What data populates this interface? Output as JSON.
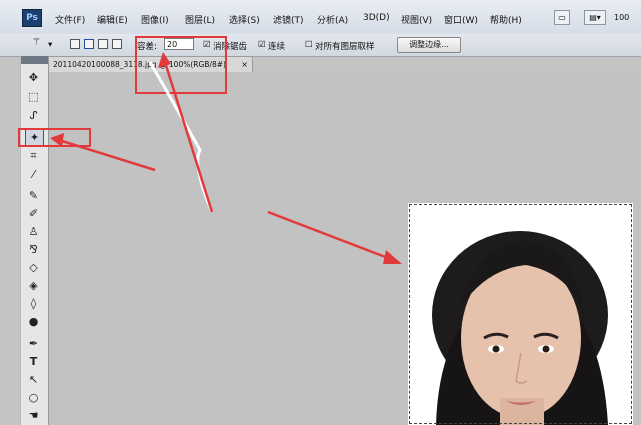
{
  "app": {
    "logo": "Ps"
  },
  "menu": [
    {
      "label": "文件(F)"
    },
    {
      "label": "编辑(E)"
    },
    {
      "label": "图像(I)"
    },
    {
      "label": "图层(L)"
    },
    {
      "label": "选择(S)"
    },
    {
      "label": "滤镜(T)"
    },
    {
      "label": "分析(A)"
    },
    {
      "label": "3D(D)"
    },
    {
      "label": "视图(V)"
    },
    {
      "label": "窗口(W)"
    },
    {
      "label": "帮助(H)"
    }
  ],
  "zoom_indicator": "100",
  "options": {
    "tolerance_label": "容差:",
    "tolerance_value": "20",
    "antialias_label": "消除锯齿",
    "contiguous_label": "连续",
    "sample_all_label": "对所有图层取样",
    "refine_edge_label": "调整边缘..."
  },
  "document": {
    "tab_title": "20110420100088_3118.jpg @ 100%(RGB/8#)",
    "tab_close": "×"
  },
  "tools": [
    {
      "name": "move-tool-icon",
      "glyph": "✥"
    },
    {
      "name": "marquee-tool-icon",
      "glyph": "⬚"
    },
    {
      "name": "lasso-tool-icon",
      "glyph": "ᔑ"
    },
    {
      "name": "magic-wand-tool-icon",
      "glyph": "✦"
    },
    {
      "name": "crop-tool-icon",
      "glyph": "⌗"
    },
    {
      "name": "eyedropper-tool-icon",
      "glyph": "⁄"
    },
    {
      "name": "healing-brush-tool-icon",
      "glyph": "✎"
    },
    {
      "name": "brush-tool-icon",
      "glyph": "✐"
    },
    {
      "name": "clone-stamp-tool-icon",
      "glyph": "♙"
    },
    {
      "name": "history-brush-tool-icon",
      "glyph": "⅋"
    },
    {
      "name": "eraser-tool-icon",
      "glyph": "◇"
    },
    {
      "name": "paint-bucket-tool-icon",
      "glyph": "◈"
    },
    {
      "name": "blur-tool-icon",
      "glyph": "◊"
    },
    {
      "name": "dodge-tool-icon",
      "glyph": "●"
    },
    {
      "name": "pen-tool-icon",
      "glyph": "✒"
    },
    {
      "name": "type-tool-icon",
      "glyph": "T"
    },
    {
      "name": "path-selection-tool-icon",
      "glyph": "↖"
    },
    {
      "name": "shape-tool-icon",
      "glyph": "○"
    },
    {
      "name": "hand-tool-icon",
      "glyph": "☚"
    }
  ],
  "colors": {
    "annotation": "#e23a3a",
    "canvas": "#c2c2c2"
  }
}
